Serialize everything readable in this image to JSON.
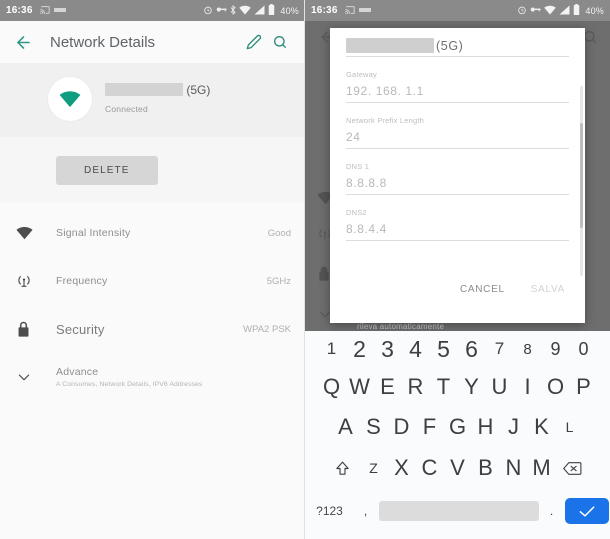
{
  "status_bar": {
    "clock": "16:36",
    "battery_text": "40%",
    "left_icons": [
      "cast-icon",
      "sim-icon"
    ],
    "right_icons": [
      "alarm-icon",
      "vpn-key-icon",
      "bluetooth-icon",
      "wifi-icon",
      "signal-icon",
      "battery-icon"
    ]
  },
  "left_panel": {
    "toolbar": {
      "back_icon": "back-arrow-icon",
      "title": "Network Details",
      "edit_icon": "pencil-icon",
      "search_icon": "search-icon",
      "accent_color": "#2e8a7c"
    },
    "hero": {
      "wifi_icon": "wifi-icon",
      "ssid_suffix": "(5G)",
      "status": "Connected"
    },
    "delete_label": "DELETE",
    "rows": [
      {
        "icon": "wifi-signal-icon",
        "label": "Signal Intensity",
        "value": "Good",
        "sub": ""
      },
      {
        "icon": "frequency-antenna-icon",
        "label": "Frequency",
        "value": "5GHz",
        "sub": ""
      },
      {
        "icon": "lock-icon",
        "label": "Security",
        "value": "WPA2 PSK",
        "sub": ""
      },
      {
        "icon": "chevron-down-icon",
        "label": "Advance",
        "value": "",
        "sub": "A Consumes, Network Details, IPV6 Addresses"
      }
    ]
  },
  "right_panel": {
    "behind_text": "rileva automaticamente",
    "dialog": {
      "ssid_suffix": "(5G)",
      "fields": [
        {
          "label": "Gateway",
          "value": "192. 168. 1.1"
        },
        {
          "label": "Network Prefix Length",
          "value": "24"
        },
        {
          "label": "DNS 1",
          "value": "8.8.8.8"
        },
        {
          "label": "DNS2",
          "value": "8.8.4.4"
        }
      ],
      "cancel_label": "CANCEL",
      "save_label": "SALVA"
    },
    "keyboard": {
      "numbers": [
        "1",
        "2",
        "3",
        "4",
        "5",
        "6",
        "7",
        "8",
        "9",
        "0"
      ],
      "row1": [
        "Q",
        "W",
        "E",
        "R",
        "T",
        "Y",
        "U",
        "I",
        "O",
        "P"
      ],
      "row2": [
        "A",
        "S",
        "D",
        "F",
        "G",
        "H",
        "J",
        "K",
        "L"
      ],
      "row3": [
        "Z",
        "X",
        "C",
        "V",
        "B",
        "N",
        "M"
      ],
      "shift_icon": "shift-icon",
      "backspace_icon": "backspace-icon",
      "symbols_label": "?123",
      "comma_label": ",",
      "period_label": ".",
      "enter_icon": "check-icon",
      "enter_color": "#1a73e8"
    }
  }
}
